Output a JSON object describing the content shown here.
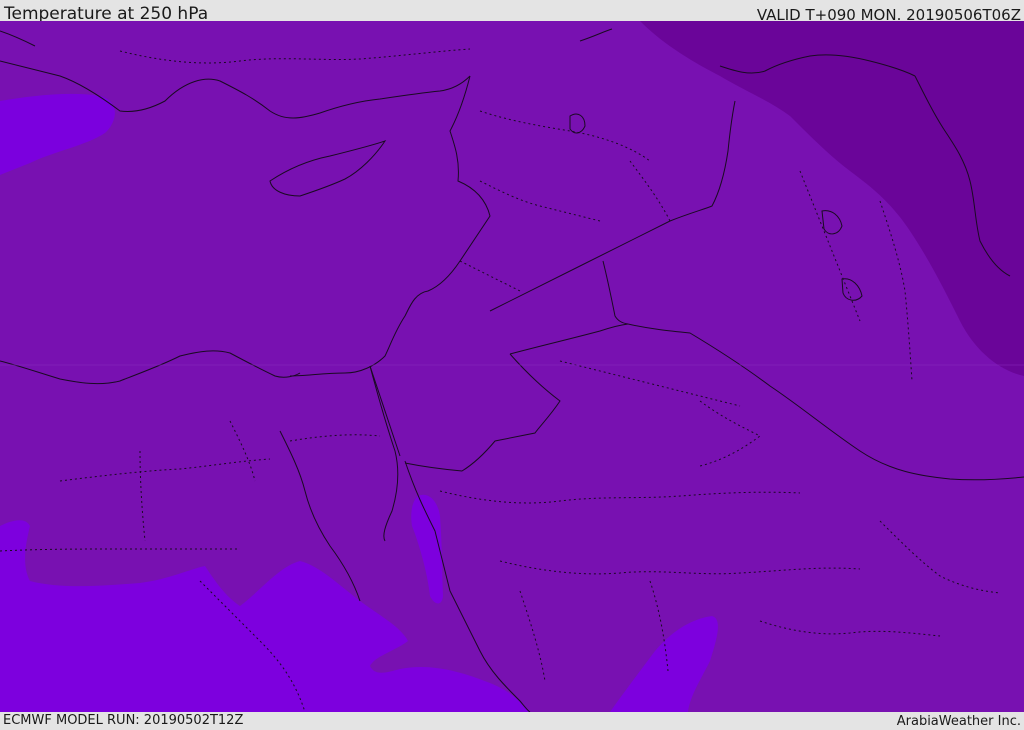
{
  "header": {
    "title": "Temperature at 250 hPa",
    "valid_time": "VALID T+090 MON. 20190506T06Z"
  },
  "footer": {
    "model_run": "ECMWF MODEL RUN: 20190502T12Z",
    "credit": "ArabiaWeather Inc."
  },
  "map": {
    "colors": {
      "base_field": "#7811b1",
      "cold_band_northeast": "#6a0599",
      "warm_band_south": "#7d00de",
      "warm_patch_west": "#7b00de",
      "coastline": "#1a0a22",
      "border_lines": "#1a0a22"
    }
  }
}
